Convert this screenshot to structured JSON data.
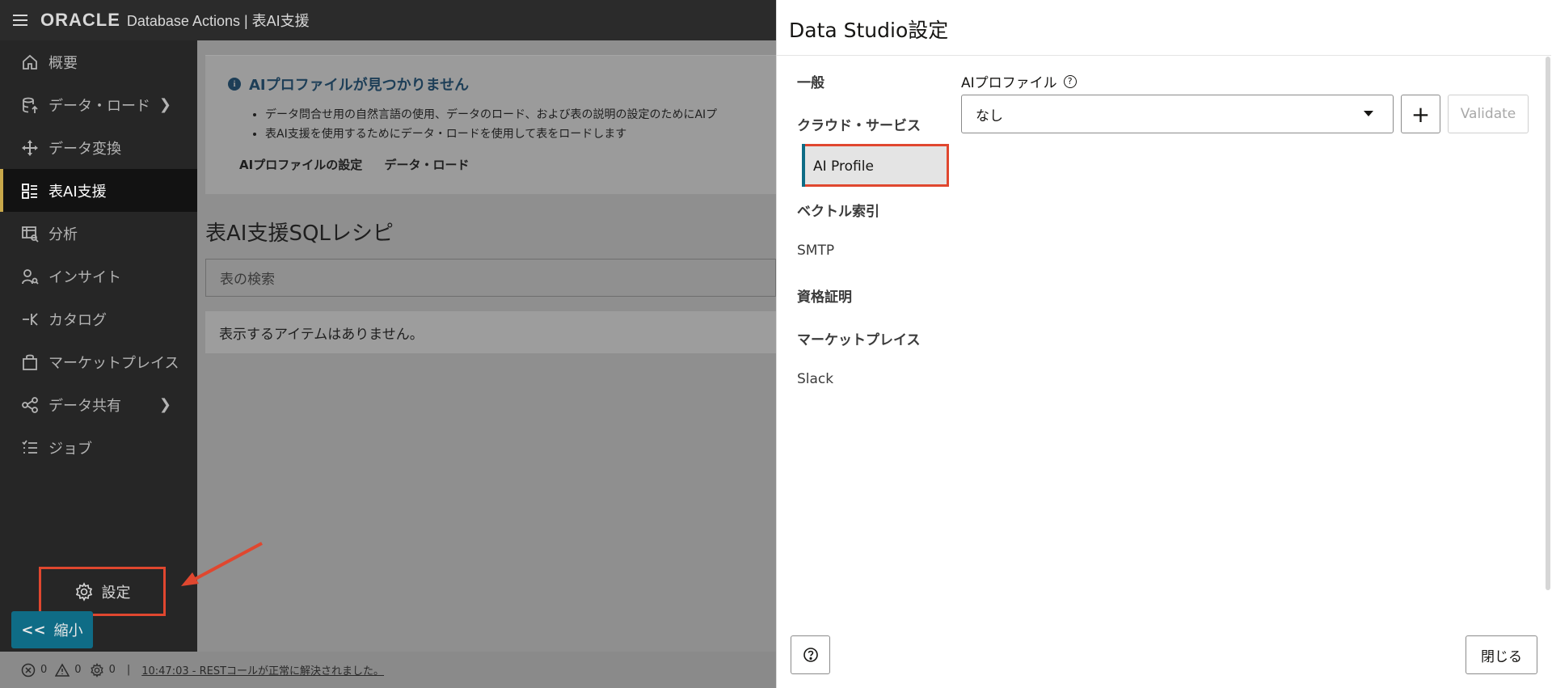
{
  "header": {
    "brand": "ORACLE",
    "subtitle": "Database Actions | 表AI支援"
  },
  "sidebar": {
    "items": [
      {
        "label": "概要",
        "icon": "home-icon",
        "has_chevron": false,
        "active": false
      },
      {
        "label": "データ・ロード",
        "icon": "database-upload-icon",
        "has_chevron": true,
        "active": false
      },
      {
        "label": "データ変換",
        "icon": "move-arrows-icon",
        "has_chevron": false,
        "active": false
      },
      {
        "label": "表AI支援",
        "icon": "table-list-icon",
        "has_chevron": false,
        "active": true
      },
      {
        "label": "分析",
        "icon": "analytics-icon",
        "has_chevron": false,
        "active": false
      },
      {
        "label": "インサイト",
        "icon": "insight-person-icon",
        "has_chevron": false,
        "active": false
      },
      {
        "label": "カタログ",
        "icon": "catalog-icon",
        "has_chevron": false,
        "active": false
      },
      {
        "label": "マーケットプレイス",
        "icon": "shopping-bag-icon",
        "has_chevron": false,
        "active": false
      },
      {
        "label": "データ共有",
        "icon": "share-icon",
        "has_chevron": true,
        "active": false
      },
      {
        "label": "ジョブ",
        "icon": "job-list-icon",
        "has_chevron": false,
        "active": false
      }
    ],
    "settings_label": "設定",
    "collapse_label": "縮小",
    "collapse_symbol": "<<"
  },
  "main": {
    "notice": {
      "title": "AIプロファイルが見つかりません",
      "bullets": [
        "データ問合せ用の自然言語の使用、データのロード、および表の説明の設定のためにAIプ",
        "表AI支援を使用するためにデータ・ロードを使用して表をロードします"
      ],
      "links": [
        "AIプロファイルの設定",
        "データ・ロード"
      ]
    },
    "page_title": "表AI支援SQLレシピ",
    "search_placeholder": "表の検索",
    "empty_message": "表示するアイテムはありません。"
  },
  "statusbar": {
    "errors": "0",
    "warnings": "0",
    "tasks": "0",
    "message": "10:47:03 - RESTコールが正常に解決されました。"
  },
  "panel": {
    "title": "Data Studio設定",
    "tabs": [
      "一般",
      "クラウド・サービス",
      "AI Profile",
      "ベクトル索引",
      "SMTP",
      "資格証明",
      "マーケットプレイス",
      "Slack"
    ],
    "selected_tab": "AI Profile",
    "field_label": "AIプロファイル",
    "field_value": "なし",
    "add_symbol": "+",
    "validate_label": "Validate",
    "close_label": "閉じる"
  },
  "colors": {
    "accent": "#0f6c86",
    "highlight": "#e0472f",
    "active_border": "#c8a84a"
  }
}
